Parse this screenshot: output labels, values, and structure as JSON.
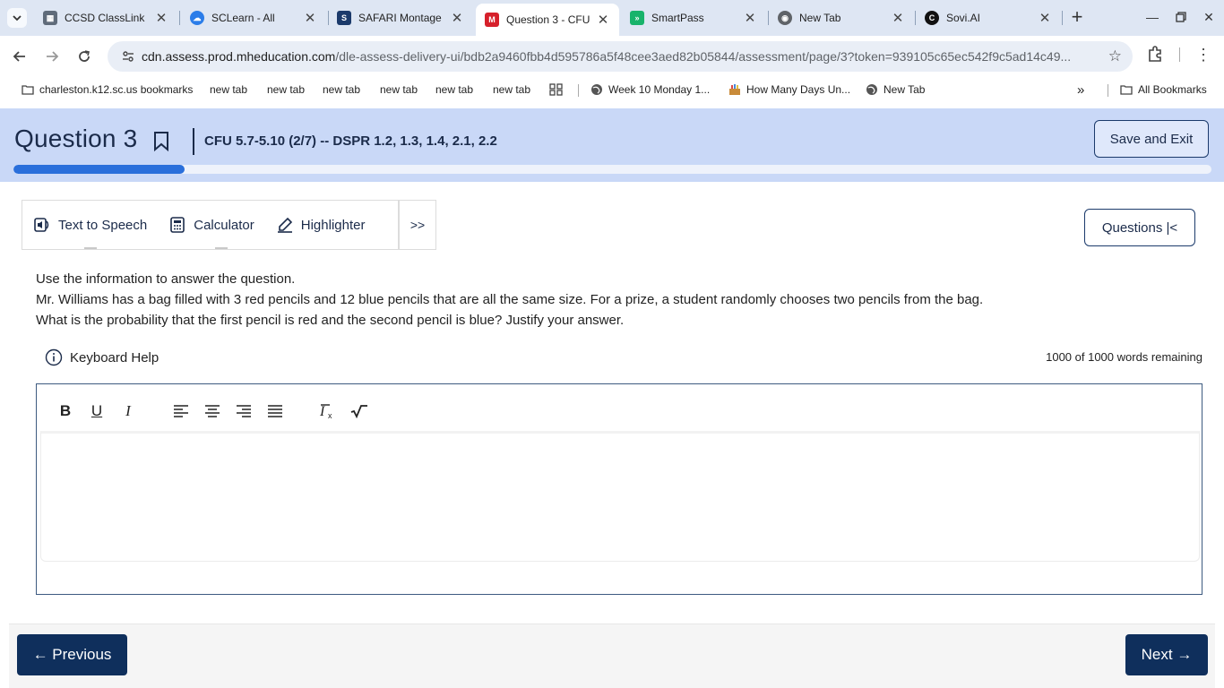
{
  "browser": {
    "tabs": [
      {
        "title": "CCSD ClassLink",
        "icon": "classlink-icon",
        "color": "#5f6b7a"
      },
      {
        "title": "SCLearn - All",
        "icon": "sclearn-icon",
        "color": "#2b7de9"
      },
      {
        "title": "SAFARI Montage",
        "icon": "safari-montage-icon",
        "color": "#1b3a6b"
      },
      {
        "title": "Question 3 - CFU",
        "icon": "mheducation-icon",
        "color": "#d6202b"
      },
      {
        "title": "SmartPass",
        "icon": "smartpass-icon",
        "color": "#18b36b"
      },
      {
        "title": "New Tab",
        "icon": "chrome-icon",
        "color": "#5f6368"
      },
      {
        "title": "Sovi.AI",
        "icon": "sovi-icon",
        "color": "#111111"
      }
    ],
    "url_host": "cdn.assess.prod.mheducation.com",
    "url_path": "/dle-assess-delivery-ui/bdb2a9460fbb4d595786a5f48cee3aed82b05844/assessment/page/3?token=939105c65ec542f9c5ad14c49...",
    "bookmarks": [
      {
        "label": "charleston.k12.sc.us bookmarks",
        "icon": "folder-link-icon"
      },
      {
        "label": "new tab"
      },
      {
        "label": "new tab"
      },
      {
        "label": "new tab"
      },
      {
        "label": "new tab"
      },
      {
        "label": "new tab"
      },
      {
        "label": "new tab"
      },
      {
        "label": "",
        "icon": "apps-grid-icon"
      },
      {
        "label": "Week 10 Monday 1...",
        "icon": "globe-icon"
      },
      {
        "label": "How Many Days Un...",
        "icon": "calendar-emoji-icon"
      },
      {
        "label": "New Tab",
        "icon": "globe-icon"
      }
    ],
    "bookmarks_overflow": "»",
    "all_bookmarks": "All Bookmarks"
  },
  "header": {
    "question_title": "Question 3",
    "assessment_title": "CFU 5.7-5.10 (2/7) -- DSPR 1.2, 1.3, 1.4, 2.1, 2.2",
    "save_exit": "Save and Exit",
    "progress_fraction": 0.143
  },
  "tools": {
    "tts": "Text to Speech",
    "calculator": "Calculator",
    "highlighter": "Highlighter",
    "more": ">>"
  },
  "questions_button": "Questions |<",
  "question": {
    "line1": "Use the information to answer the question.",
    "line2": "Mr. Williams has a bag filled with 3 red pencils and 12 blue pencils that are all the same size. For a prize, a student randomly chooses two pencils from the bag.",
    "line3": "What is the probability that the first pencil is red and the second pencil is blue? Justify your answer."
  },
  "keyboard_help": "Keyboard Help",
  "word_count": "1000 of 1000 words remaining",
  "editor": {
    "buttons": [
      "bold-icon",
      "underline-icon",
      "italic-icon",
      "align-left-icon",
      "align-center-icon",
      "align-right-icon",
      "align-justify-icon",
      "clear-format-icon",
      "math-sqrt-icon"
    ],
    "value": ""
  },
  "footer": {
    "previous": "← Previous",
    "next": "Next →"
  }
}
